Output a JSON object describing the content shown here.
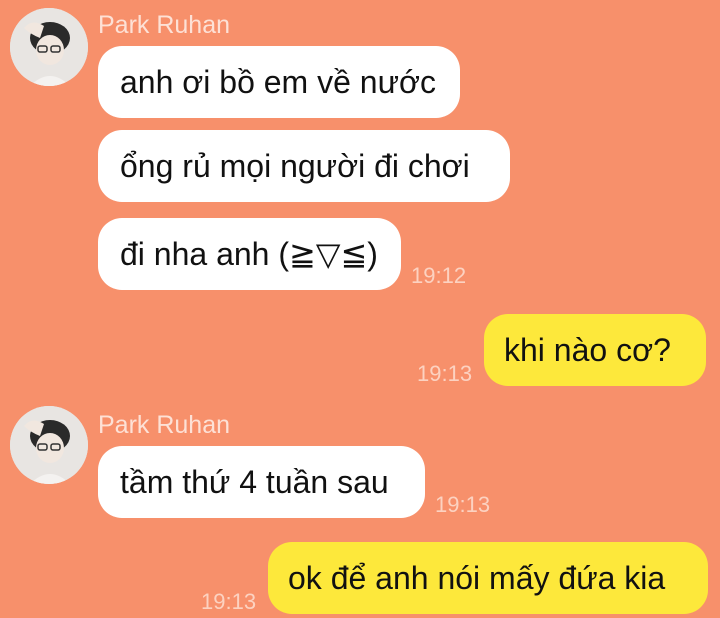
{
  "colors": {
    "background": "#f7906b",
    "incoming_bubble": "#ffffff",
    "outgoing_bubble": "#fde83b",
    "sender_name": "#fde1d6",
    "timestamp": "#fcd2c1"
  },
  "groups": [
    {
      "sender": "Park Ruhan",
      "avatar": "user-avatar",
      "messages": [
        {
          "text": "anh ơi bồ em về nước"
        },
        {
          "text": "ổng rủ mọi người đi chơi"
        },
        {
          "text": "đi nha anh (≧▽≦)",
          "time": "19:12"
        }
      ]
    },
    {
      "sender": "me",
      "messages": [
        {
          "text": "khi nào cơ?",
          "time": "19:13"
        }
      ]
    },
    {
      "sender": "Park Ruhan",
      "avatar": "user-avatar",
      "messages": [
        {
          "text": "tầm thứ 4 tuần sau",
          "time": "19:13"
        }
      ]
    },
    {
      "sender": "me",
      "messages": [
        {
          "text": "ok để anh nói mấy đứa kia",
          "time": "19:13"
        }
      ]
    }
  ]
}
